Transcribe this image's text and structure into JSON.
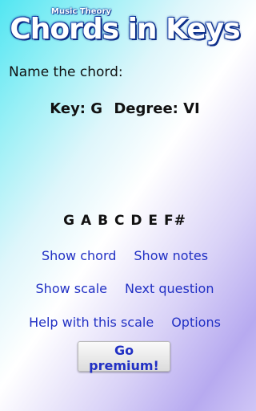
{
  "logo": {
    "subtitle": "Music Theory",
    "title": "Chords in Keys"
  },
  "prompt": "Name the chord:",
  "question": {
    "key_label": "Key: G",
    "degree_label": "Degree: VI"
  },
  "scale_notes": "G A B C D E F#",
  "links": {
    "show_chord": "Show chord",
    "show_notes": "Show notes",
    "show_scale": "Show scale",
    "next_question": "Next question",
    "help_scale": "Help with this scale",
    "options": "Options"
  },
  "premium_button": "Go premium!"
}
